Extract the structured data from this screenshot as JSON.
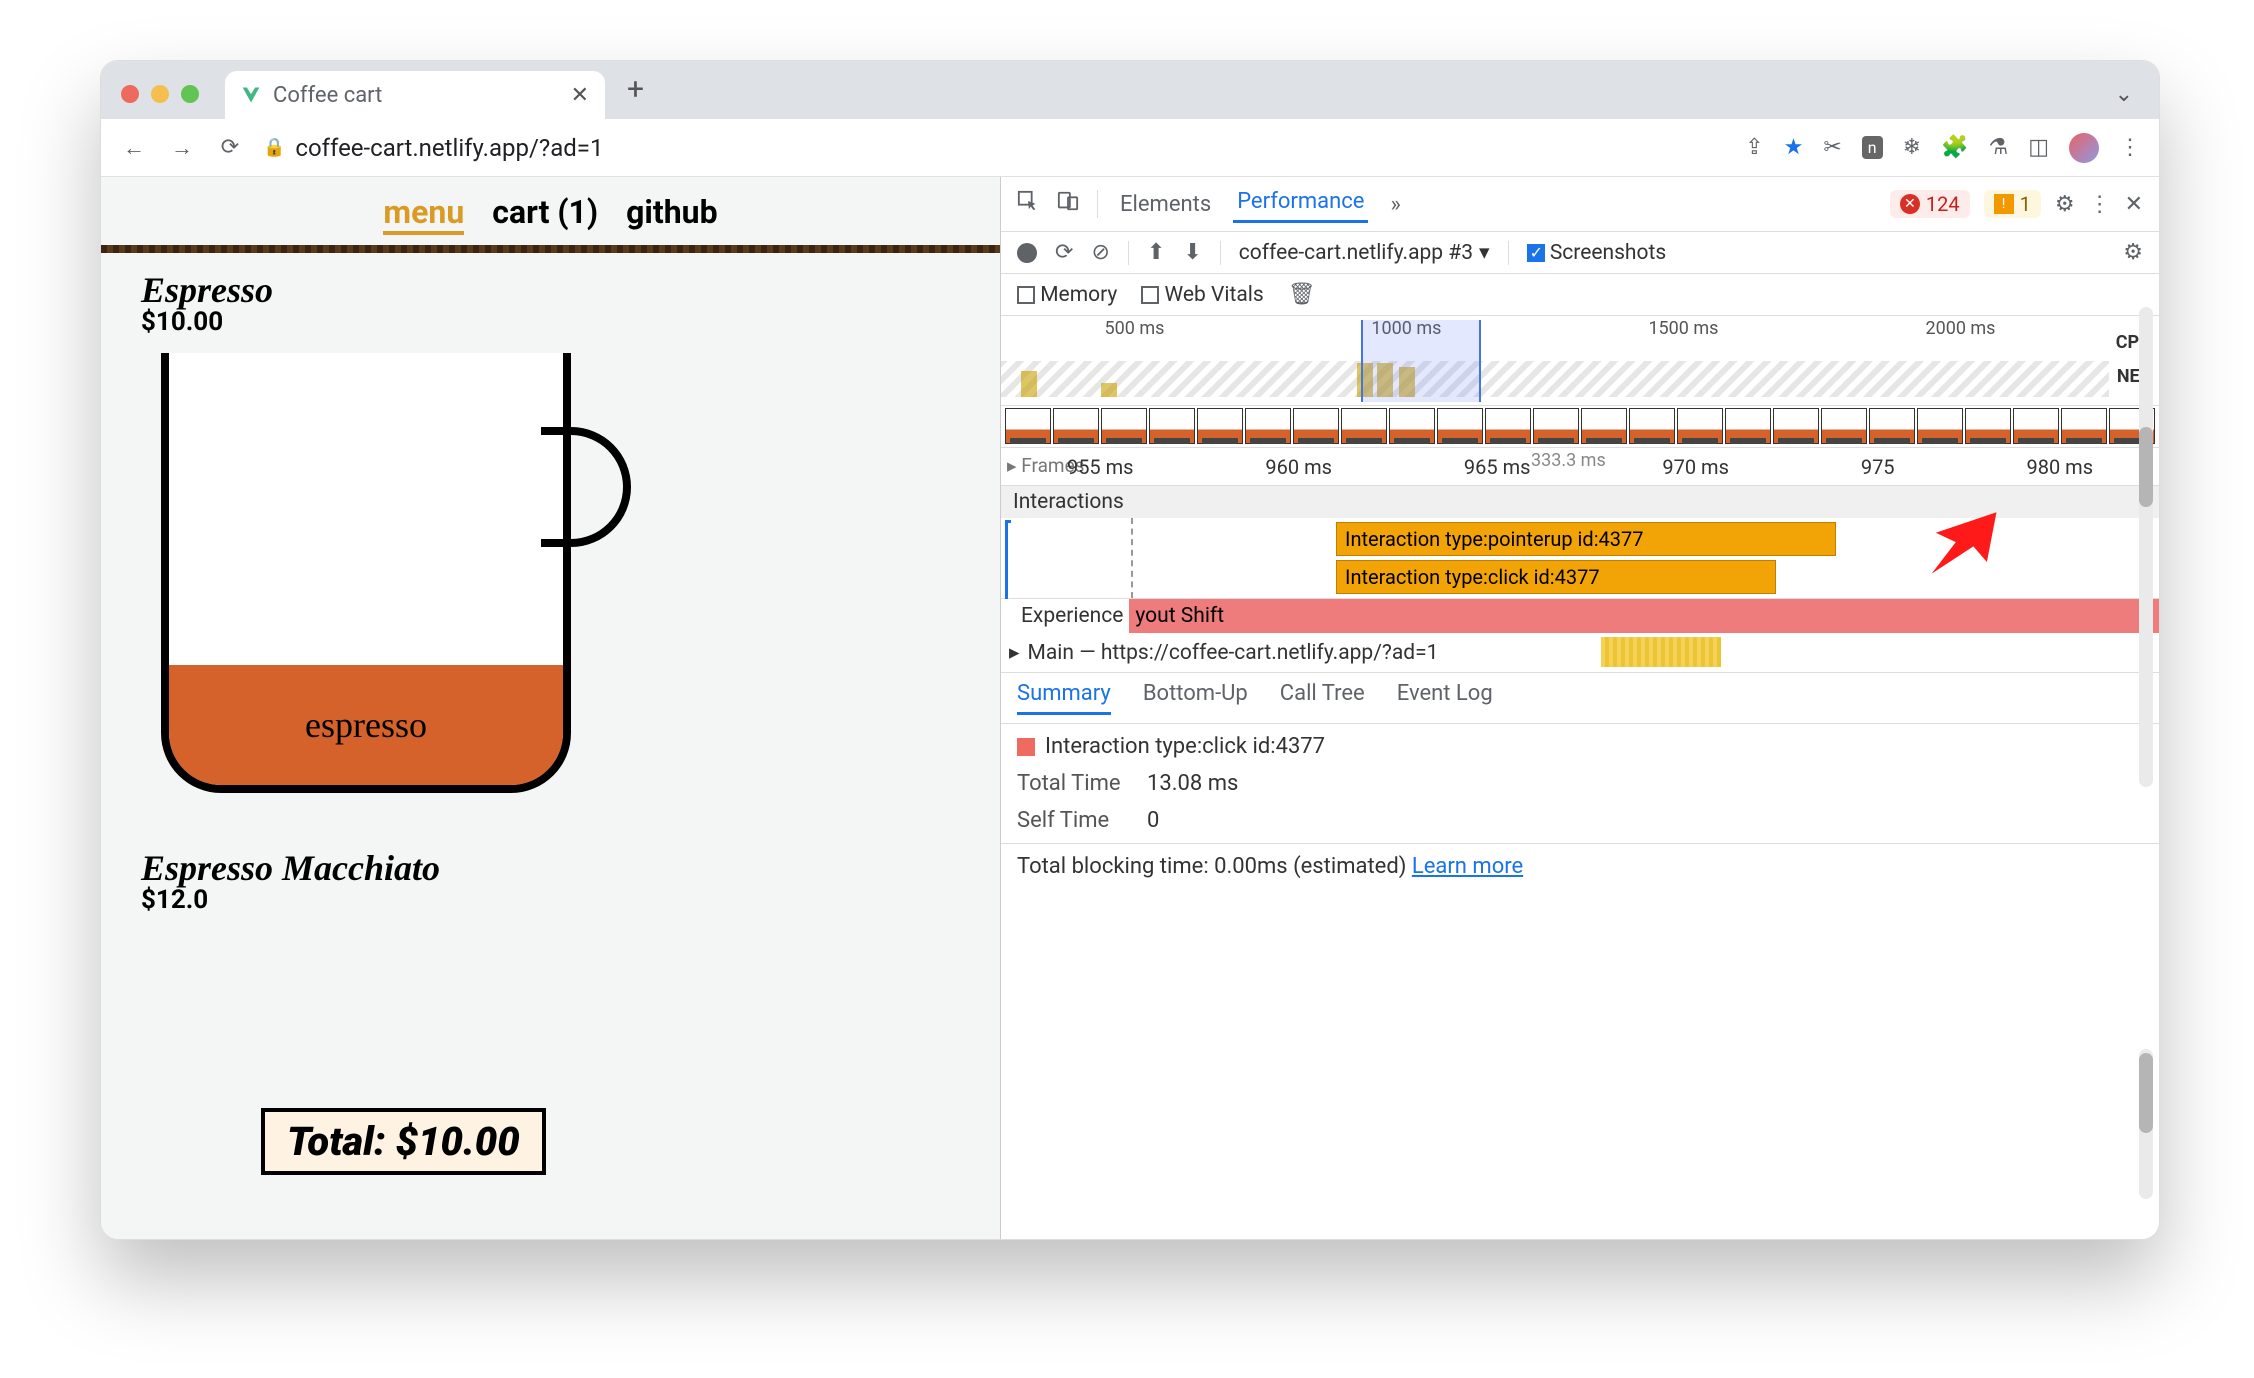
{
  "browser": {
    "tab_title": "Coffee cart",
    "url": "coffee-cart.netlify.app/?ad=1"
  },
  "page_nav": {
    "menu": "menu",
    "cart": "cart (1)",
    "github": "github"
  },
  "products": {
    "p1": {
      "name": "Espresso",
      "price": "$10.00",
      "fill_label": "espresso"
    },
    "p2": {
      "name": "Espresso Macchiato",
      "price": "$12.0"
    }
  },
  "total_float": "Total: $10.00",
  "devtools": {
    "tabs": {
      "elements": "Elements",
      "performance": "Performance",
      "more": "»"
    },
    "error_count": "124",
    "warn_count": "1",
    "recording_name": "coffee-cart.netlify.app #3",
    "screenshots_label": "Screenshots",
    "memory_label": "Memory",
    "webvitals_label": "Web Vitals",
    "overview_ticks": {
      "t1": "500 ms",
      "t2": "1000 ms",
      "t3": "1500 ms",
      "t4": "2000 ms"
    },
    "cpu_label": "CPU",
    "net_label": "NET",
    "frames_label": "Frames",
    "zoom_ticks": {
      "a": "955 ms",
      "b": "960 ms",
      "c": "965 ms",
      "d": "970 ms",
      "e": "975",
      "f": "980 ms"
    },
    "fps_hint": "333.3 ms",
    "interactions_label": "Interactions",
    "inter_row1": "Interaction type:pointerup id:4377",
    "inter_row2": "Interaction type:click id:4377",
    "experience_label": "Experience",
    "layout_shift": "yout Shift",
    "main_label": "Main — https://coffee-cart.netlify.app/?ad=1",
    "subtabs": {
      "summary": "Summary",
      "bottomup": "Bottom-Up",
      "calltree": "Call Tree",
      "eventlog": "Event Log"
    },
    "summary_title": "Interaction type:click id:4377",
    "total_time_label": "Total Time",
    "total_time_value": "13.08 ms",
    "self_time_label": "Self Time",
    "self_time_value": "0",
    "blocking_text": "Total blocking time: 0.00ms (estimated)",
    "learn_more": "Learn more"
  }
}
